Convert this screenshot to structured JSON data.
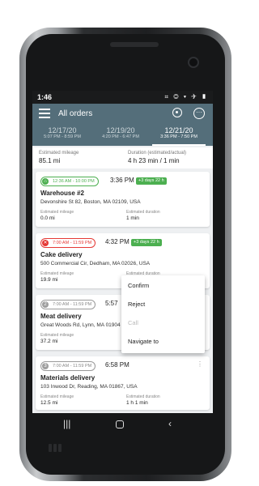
{
  "status": {
    "time": "1:46",
    "icons": "⌗ ◎ ▾ ✈ ▮"
  },
  "appbar": {
    "title": "All orders"
  },
  "dates": [
    {
      "date": "12/17/20",
      "range": "5:07 PM - 8:59 PM"
    },
    {
      "date": "12/19/20",
      "range": "4:20 PM - 6:47 PM"
    },
    {
      "date": "12/21/20",
      "range": "3:36 PM - 7:50 PM"
    }
  ],
  "summary": {
    "mileage_label": "Estimated mileage",
    "mileage_value": "85.1  mi",
    "duration_label": "Duration (estimated/actual)",
    "duration_value": "4 h 23 min / 1 min"
  },
  "orders": [
    {
      "window": "12:36 AM - 10:00 PM",
      "time": "3:36 PM",
      "late": "+3 days 22 h",
      "name": "Warehouse #2",
      "address": "Devonshire St 82, Boston, MA 02109, USA",
      "mileage_label": "Estimated mileage",
      "mileage": "0.0  mi",
      "duration_label": "Estimated duration",
      "duration": "1 min"
    },
    {
      "window": "7:00 AM - 11:59 PM",
      "time": "4:32 PM",
      "late": "+3 days 22 h",
      "name": "Cake delivery",
      "address": "500 Commercial Cir, Dedham, MA 02026, USA",
      "mileage_label": "Estimated mileage",
      "mileage": "19.9  mi",
      "duration_label": "Estimated duration",
      "duration": ""
    },
    {
      "badge": "2",
      "window": "7:00 AM - 11:59 PM",
      "time": "5:57",
      "name": "Meat delivery",
      "address": "Great Woods Rd, Lynn, MA 01904",
      "mileage_label": "Estimated mileage",
      "mileage": "37.2  mi"
    },
    {
      "badge": "3",
      "window": "7:00 AM - 11:59 PM",
      "time": "6:58 PM",
      "name": "Materials delivery",
      "address": "103 Inwood Dr, Reading, MA 01867, USA",
      "mileage_label": "Estimated mileage",
      "mileage": "12.5  mi",
      "duration_label": "Estimated duration",
      "duration": "1 h 1 min"
    }
  ],
  "context_menu": [
    "Confirm",
    "Reject",
    "Call",
    "Navigate to"
  ],
  "colors": {
    "appbar": "#546e7a",
    "green": "#4caf50",
    "red": "#e53935"
  }
}
